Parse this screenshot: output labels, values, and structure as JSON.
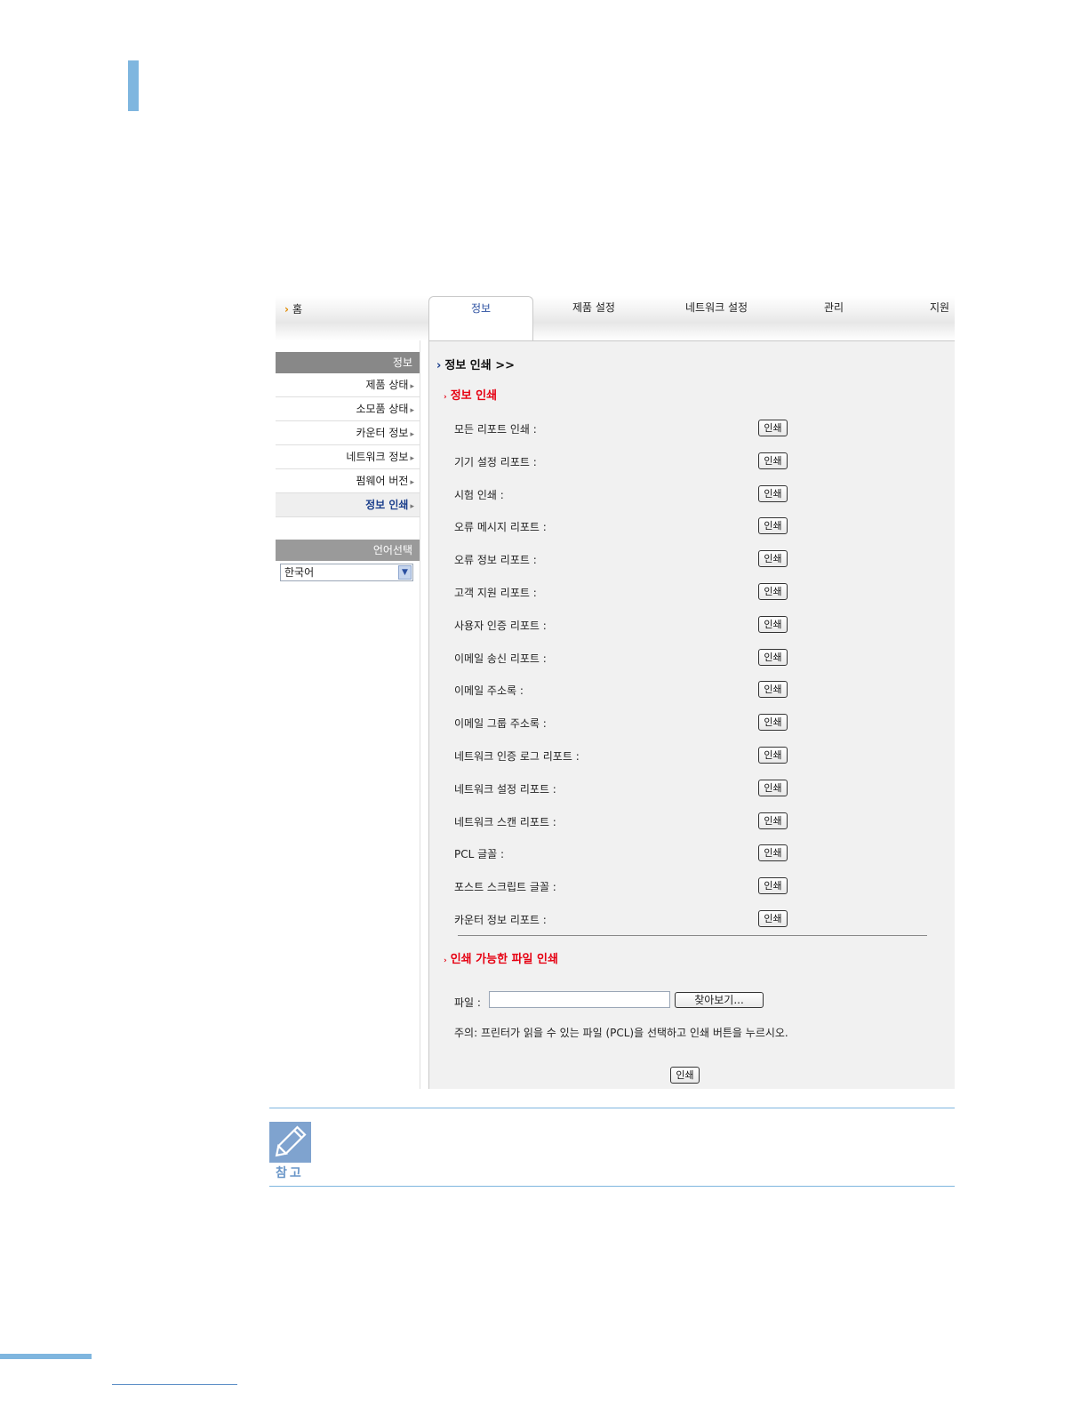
{
  "nav": {
    "home": "홈",
    "tabs": [
      "정보",
      "제품 설정",
      "네트워크 설정",
      "관리",
      "지원"
    ]
  },
  "sidebar": {
    "header": "정보",
    "items": [
      "제품 상태",
      "소모품 상태",
      "카운터 정보",
      "네트워크 정보",
      "펌웨어 버전",
      "정보 인쇄"
    ],
    "active_item": "정보 인쇄",
    "language_header": "언어선택",
    "language_value": "한국어"
  },
  "main": {
    "title": "정보 인쇄 >>",
    "section1": "정보 인쇄",
    "reports": [
      "모든 리포트 인쇄 :",
      "기기 설정 리포트 :",
      "시험 인쇄 :",
      "오류 메시지 리포트 :",
      "오류 정보 리포트 :",
      "고객 지원 리포트 :",
      "사용자 인증 리포트 :",
      "이메일 송신 리포트 :",
      "이메일 주소록 :",
      "이메일 그룹 주소록 :",
      "네트워크 인증 로그 리포트 :",
      "네트워크 설정 리포트 :",
      "네트워크 스캔 리포트 :",
      "PCL 글꼴 :",
      "포스트 스크립트 글꼴 :",
      "카운터 정보 리포트 :"
    ],
    "print_label": "인쇄",
    "section2": "인쇄 가능한 파일 인쇄",
    "file_label": "파일 :",
    "browse_label": "찾아보기...",
    "note_text": "주의: 프린터가 읽을 수 있는 파일 (PCL)을 선택하고 인쇄 버튼을 누르시오.",
    "submit_label": "인쇄"
  },
  "note": {
    "label": "참고",
    "icon": "pencil-icon"
  },
  "colors": {
    "accent": "#7fb6df",
    "section_red": "#e60012",
    "nav_blue": "#1b3f8c"
  }
}
